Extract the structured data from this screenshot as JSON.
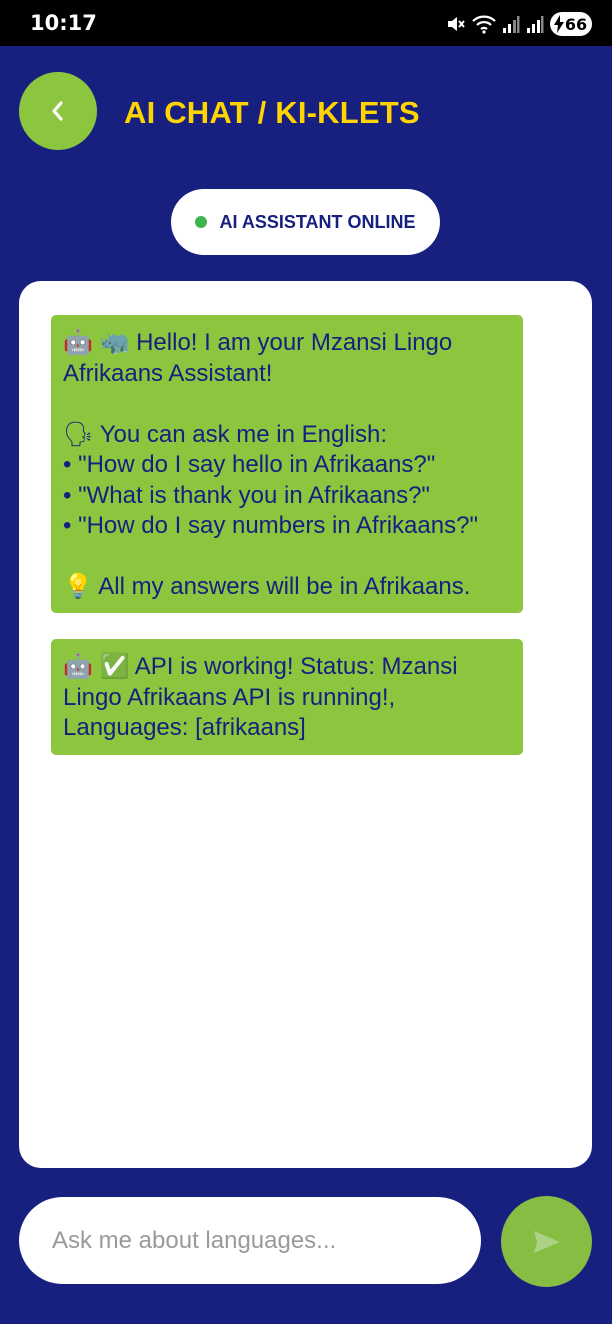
{
  "status_bar": {
    "time": "10:17",
    "battery": "66"
  },
  "header": {
    "title": "AI CHAT / KI-KLETS",
    "back_icon": "chevron-left-icon"
  },
  "status_pill": {
    "label": "AI ASSISTANT ONLINE",
    "dot_color": "#3cb44b"
  },
  "messages": [
    {
      "sender": "assistant",
      "text": "🤖 🦏 Hello! I am your Mzansi Lingo Afrikaans Assistant!\n\n🗣 You can ask me in English:\n• \"How do I say hello in Afrikaans?\"\n• \"What is thank you in Afrikaans?\"\n• \"How do I say numbers in Afrikaans?\"\n\n💡 All my answers will be in Afrikaans."
    },
    {
      "sender": "assistant",
      "text": "🤖 ✅ API is working! Status: Mzansi Lingo Afrikaans API is running!, Languages: [afrikaans]"
    }
  ],
  "input": {
    "placeholder": "Ask me about languages...",
    "value": ""
  },
  "send": {
    "icon": "send-icon"
  },
  "colors": {
    "background": "#17207f",
    "accent": "#8cc63f",
    "title": "#ffd400",
    "text": "#17207f"
  }
}
